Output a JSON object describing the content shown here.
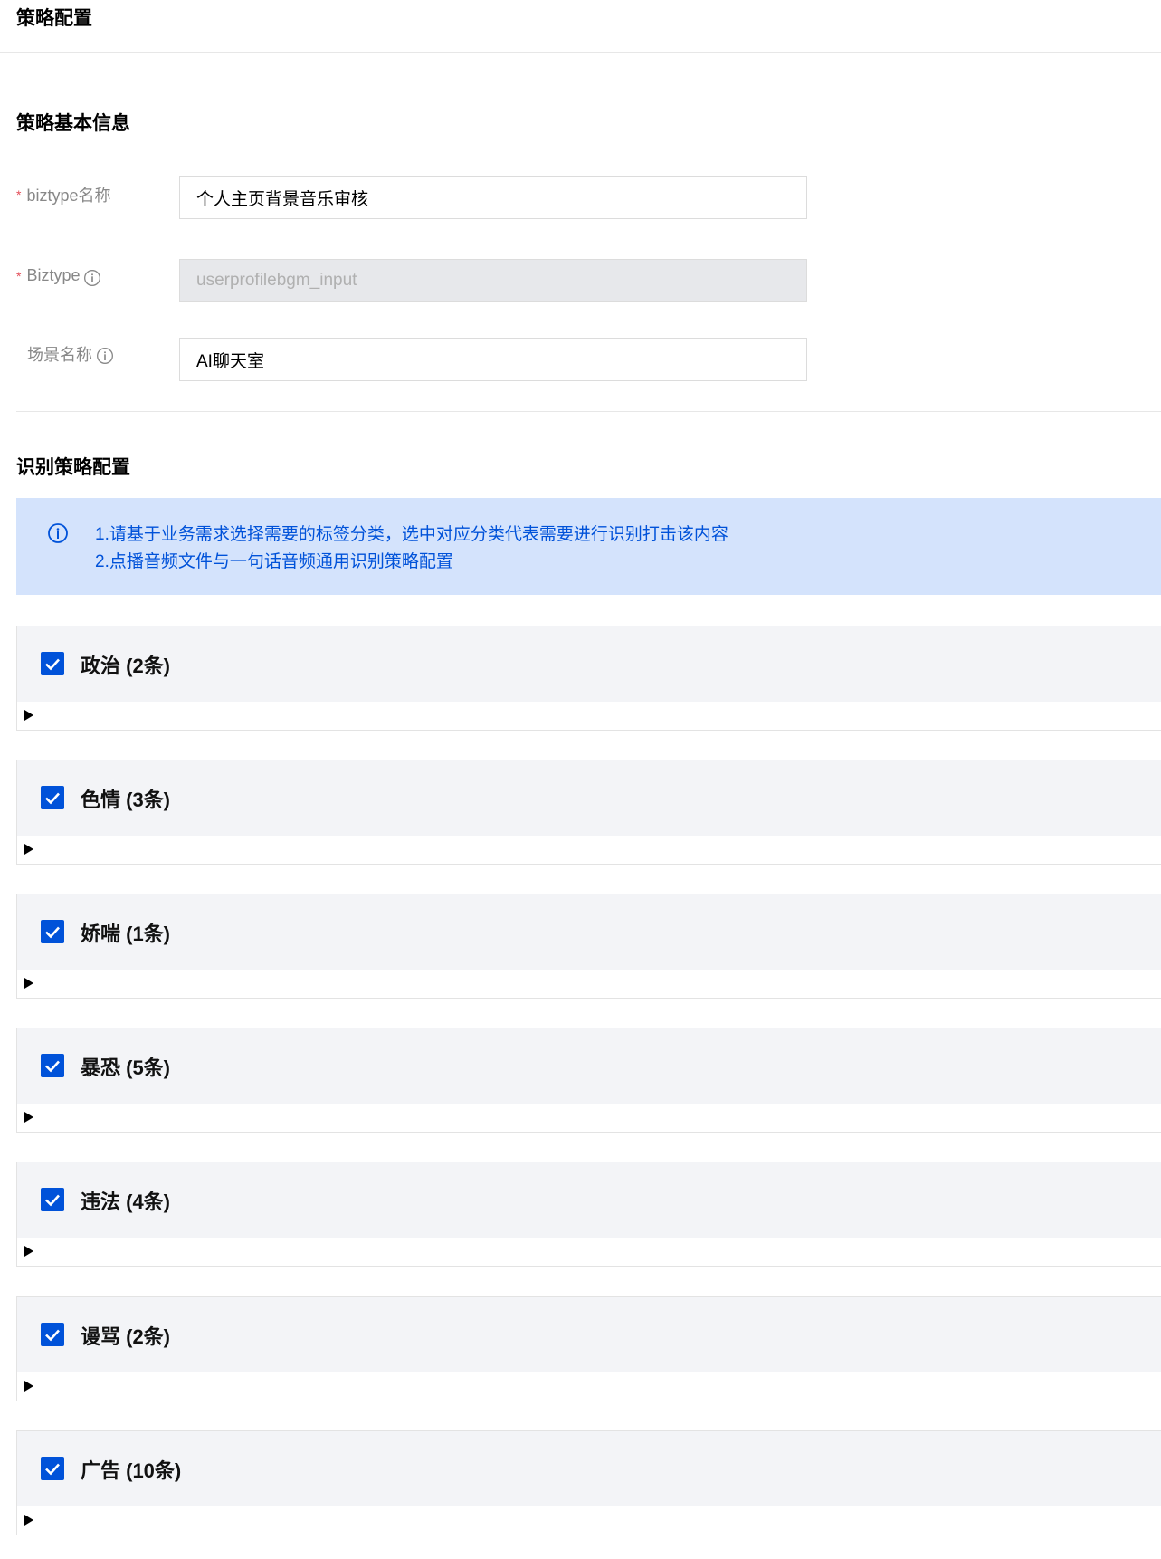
{
  "page": {
    "title": "策略配置"
  },
  "basic_info": {
    "section_title": "策略基本信息",
    "fields": [
      {
        "label": "biztype名称",
        "required": true,
        "has_info_icon": false,
        "value": "个人主页背景音乐审核",
        "disabled": false
      },
      {
        "label": "Biztype",
        "required": true,
        "has_info_icon": true,
        "value": "userprofilebgm_input",
        "disabled": true
      },
      {
        "label": "场景名称",
        "required": false,
        "has_info_icon": true,
        "value": "AI聊天室",
        "disabled": false
      }
    ],
    "required_mark": "*"
  },
  "recognition": {
    "section_title": "识别策略配置",
    "notice": {
      "icon": "info-circle-icon",
      "lines": [
        "1.请基于业务需求选择需要的标签分类，选中对应分类代表需要进行识别打击该内容",
        "2.点播音频文件与一句话音频通用识别策略配置"
      ]
    },
    "categories": [
      {
        "title": "政治 (2条)",
        "checked": true
      },
      {
        "title": "色情 (3条)",
        "checked": true
      },
      {
        "title": "娇喘 (1条)",
        "checked": true
      },
      {
        "title": "暴恐 (5条)",
        "checked": true
      },
      {
        "title": "违法 (4条)",
        "checked": true
      },
      {
        "title": "谩骂 (2条)",
        "checked": true
      },
      {
        "title": "广告 (10条)",
        "checked": true
      }
    ]
  },
  "colors": {
    "accent": "#0052d9",
    "notice_bg": "#d4e3fc",
    "required": "#e34d59",
    "category_header_bg": "#f3f4f7"
  }
}
